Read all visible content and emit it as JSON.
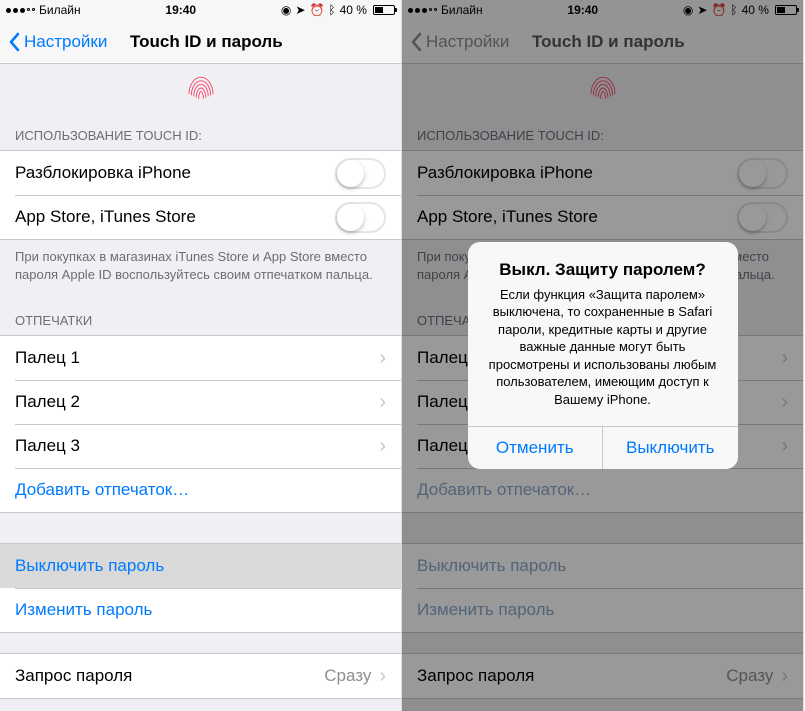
{
  "status": {
    "carrier": "Билайн",
    "time": "19:40",
    "battery_text": "40 %",
    "battery_pct": 40
  },
  "nav": {
    "back": "Настройки",
    "title": "Touch ID и пароль"
  },
  "sections": {
    "usage_header": "ИСПОЛЬЗОВАНИЕ TOUCH ID:",
    "unlock_label": "Разблокировка iPhone",
    "store_label": "App Store, iTunes Store",
    "usage_footer": "При покупках в магазинах iTunes Store и App Store вместо пароля Apple ID воспользуйтесь своим отпечатком пальца.",
    "prints_header": "ОТПЕЧАТКИ",
    "prints": [
      "Палец 1",
      "Палец 2",
      "Палец 3"
    ],
    "add_print": "Добавить отпечаток…",
    "disable_pass": "Выключить пароль",
    "change_pass": "Изменить пароль",
    "require_label": "Запрос пароля",
    "require_value": "Сразу"
  },
  "alert": {
    "title": "Выкл. Защиту паролем?",
    "message": "Если функция «Защита паролем» выключена, то сохраненные в Safari пароли, кредитные карты и другие важные данные могут быть просмотрены и использованы любым пользователем, имеющим доступ к Вашему iPhone.",
    "cancel": "Отменить",
    "confirm": "Выключить"
  }
}
